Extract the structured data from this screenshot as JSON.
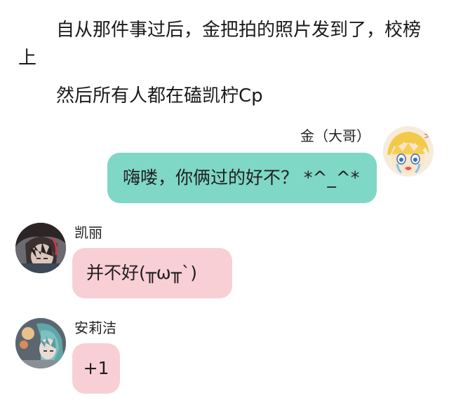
{
  "narration": {
    "line1": "自从那件事过后，金把拍的照片发到了，校榜上",
    "line2": "然后所有人都在磕凯柠Cp"
  },
  "messages": [
    {
      "sender": "金（大哥）",
      "side": "right",
      "text": "嗨喽，你俩过的好不？ *^_^*",
      "bubble_color": "#7fd7c6"
    },
    {
      "sender": "凯丽",
      "side": "left",
      "text": "并不好(╥ω╥`)",
      "bubble_color": "#f9cfd6"
    },
    {
      "sender": "安莉洁",
      "side": "left",
      "text": "+1",
      "bubble_color": "#f9cfd6"
    }
  ],
  "avatars": {
    "jin": "blonde-chibi-crying-avatar",
    "kaili": "dark-haired-anime-avatar",
    "anlijie": "teal-haired-anime-avatar"
  }
}
